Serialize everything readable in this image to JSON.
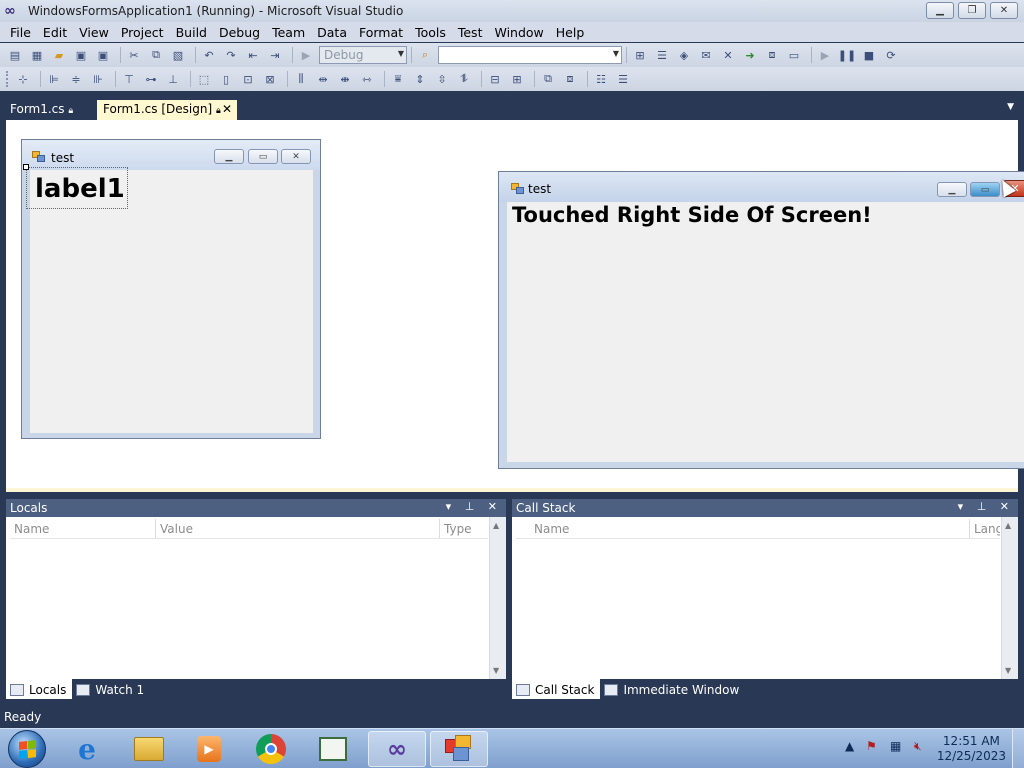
{
  "window": {
    "title": "WindowsFormsApplication1 (Running) - Microsoft Visual Studio",
    "controls": [
      "minimize",
      "restore",
      "close"
    ]
  },
  "menu": [
    "File",
    "Edit",
    "View",
    "Project",
    "Build",
    "Debug",
    "Team",
    "Data",
    "Format",
    "Tools",
    "Test",
    "Window",
    "Help"
  ],
  "toolbar": {
    "config_value": "Debug",
    "find_value": ""
  },
  "doc_tabs": [
    {
      "label": "Form1.cs",
      "active": false
    },
    {
      "label": "Form1.cs [Design]",
      "active": true
    }
  ],
  "design_form": {
    "title": "test",
    "label_text": "label1"
  },
  "running_form": {
    "title": "test",
    "message": "Touched Right Side Of Screen!"
  },
  "locals_panel": {
    "title": "Locals",
    "columns": [
      "Name",
      "Value",
      "Type"
    ],
    "tabs": [
      "Locals",
      "Watch 1"
    ]
  },
  "callstack_panel": {
    "title": "Call Stack",
    "columns": [
      "Name",
      "Lang"
    ],
    "tabs": [
      "Call Stack",
      "Immediate Window"
    ]
  },
  "status": {
    "text": "Ready"
  },
  "taskbar": {
    "apps": [
      "internet-explorer-icon",
      "file-explorer-icon",
      "media-player-icon",
      "chrome-icon",
      "document-icon",
      "visual-studio-icon",
      "form-app-icon"
    ],
    "time": "12:51 AM",
    "date": "12/25/2023"
  },
  "colors": {
    "vs_frame": "#293955",
    "active_tab": "#fff8d1",
    "panel_header": "#4d6082",
    "close_red": "#c2351b"
  }
}
